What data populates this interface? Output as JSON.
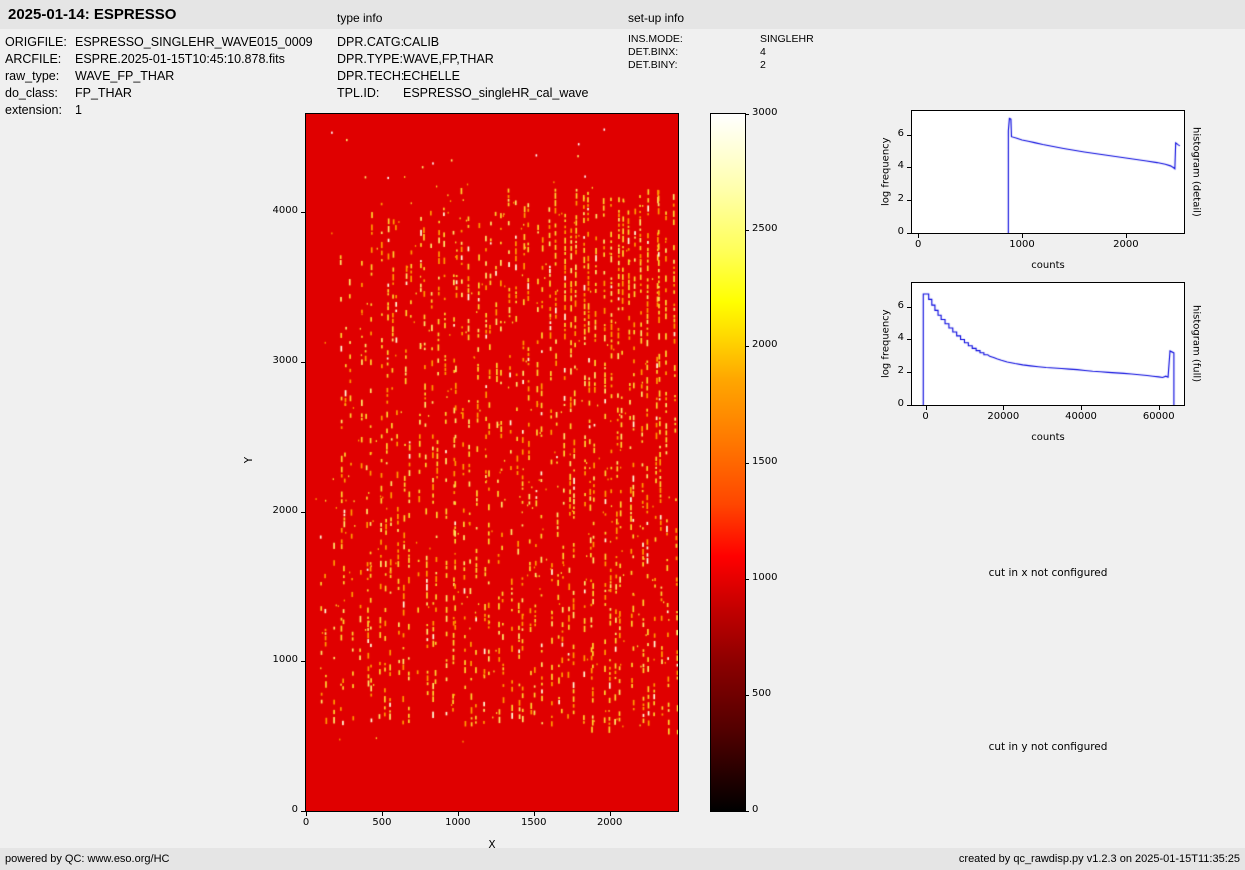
{
  "header": {
    "title": "2025-01-14: ESPRESSO",
    "type_info_label": "type info",
    "setup_info_label": "set-up info"
  },
  "file_info": {
    "rows": [
      {
        "label": "ORIGFILE:",
        "value": "ESPRESSO_SINGLEHR_WAVE015_0009"
      },
      {
        "label": "ARCFILE:",
        "value": "ESPRE.2025-01-15T10:45:10.878.fits"
      },
      {
        "label": "raw_type:",
        "value": "WAVE_FP_THAR"
      },
      {
        "label": "do_class:",
        "value": "FP_THAR"
      },
      {
        "label": "extension:",
        "value": "1"
      }
    ]
  },
  "type_info": {
    "rows": [
      {
        "label": "DPR.CATG:",
        "value": "CALIB"
      },
      {
        "label": "DPR.TYPE:",
        "value": "WAVE,FP,THAR"
      },
      {
        "label": "DPR.TECH:",
        "value": "ECHELLE"
      },
      {
        "label": "TPL.ID:",
        "value": "ESPRESSO_singleHR_cal_wave"
      }
    ]
  },
  "setup_info": {
    "rows": [
      {
        "label": "INS.MODE:",
        "value": "SINGLEHR"
      },
      {
        "label": "DET.BINX:",
        "value": "4"
      },
      {
        "label": "DET.BINY:",
        "value": "2"
      }
    ]
  },
  "notes": {
    "cut_x": "cut in x not configured",
    "cut_y": "cut in y not configured"
  },
  "footer": {
    "left": "powered by QC: www.eso.org/HC",
    "right": "created by qc_rawdisp.py v1.2.3 on 2025-01-15T11:35:25"
  },
  "chart_data": [
    {
      "id": "raw_image",
      "type": "heatmap",
      "xlabel": "X",
      "ylabel": "Y",
      "xlim": [
        0,
        2450
      ],
      "ylim": [
        0,
        4655
      ],
      "xticks": [
        0,
        500,
        1000,
        1500,
        2000
      ],
      "yticks": [
        0,
        1000,
        2000,
        3000,
        4000
      ],
      "colormap": "hot",
      "colorbar": {
        "min": 0,
        "max": 3000,
        "ticks": [
          0,
          500,
          1000,
          1500,
          2000,
          2500,
          3000
        ]
      },
      "background_counts": 1000,
      "background_color": "#e00000",
      "speckle_colors": [
        "#ffd22e",
        "#ff9b00",
        "#ffe96a",
        "#ffffd8"
      ],
      "speckle_region": {
        "x_min": 80,
        "x_max": 2440,
        "y_min": 520,
        "y_max": 4180
      },
      "n_order_stripes": 55,
      "description": "Raw ESPRESSO FP/ThAr calibration frame: uniform ~1000-count red background with yellow emission-line dashes along vertical echelle order stripes"
    },
    {
      "id": "histogram_detail",
      "type": "line",
      "right_label": "histogram (detail)",
      "xlabel": "counts",
      "ylabel": "log frequency",
      "xlim": [
        -60,
        2560
      ],
      "ylim": [
        0,
        7.45
      ],
      "xticks": [
        0,
        1000,
        2000
      ],
      "yticks": [
        0,
        2,
        4,
        6
      ],
      "line_color": "#0000dd",
      "points": [
        [
          868,
          0
        ],
        [
          868,
          6.25
        ],
        [
          878,
          7.0
        ],
        [
          893,
          6.95
        ],
        [
          898,
          5.88
        ],
        [
          950,
          5.78
        ],
        [
          1000,
          5.68
        ],
        [
          1060,
          5.6
        ],
        [
          1120,
          5.52
        ],
        [
          1200,
          5.4
        ],
        [
          1300,
          5.28
        ],
        [
          1400,
          5.16
        ],
        [
          1500,
          5.05
        ],
        [
          1600,
          4.95
        ],
        [
          1700,
          4.85
        ],
        [
          1800,
          4.76
        ],
        [
          1900,
          4.67
        ],
        [
          2000,
          4.58
        ],
        [
          2100,
          4.49
        ],
        [
          2200,
          4.4
        ],
        [
          2300,
          4.3
        ],
        [
          2380,
          4.2
        ],
        [
          2430,
          4.1
        ],
        [
          2460,
          3.98
        ],
        [
          2472,
          3.92
        ],
        [
          2480,
          5.5
        ],
        [
          2505,
          5.38
        ],
        [
          2520,
          5.32
        ]
      ]
    },
    {
      "id": "histogram_full",
      "type": "line",
      "right_label": "histogram (full)",
      "xlabel": "counts",
      "ylabel": "log frequency",
      "xlim": [
        -3500,
        66500
      ],
      "ylim": [
        0,
        7.45
      ],
      "xticks": [
        0,
        20000,
        40000,
        60000
      ],
      "yticks": [
        0,
        2,
        4,
        6
      ],
      "line_color": "#0000dd",
      "points": [
        [
          -600,
          0
        ],
        [
          -600,
          6.78
        ],
        [
          800,
          6.78
        ],
        [
          800,
          6.45
        ],
        [
          1600,
          6.45
        ],
        [
          1600,
          6.1
        ],
        [
          2400,
          6.1
        ],
        [
          2400,
          5.78
        ],
        [
          3200,
          5.78
        ],
        [
          3200,
          5.48
        ],
        [
          4000,
          5.48
        ],
        [
          4000,
          5.22
        ],
        [
          5000,
          5.22
        ],
        [
          5000,
          4.96
        ],
        [
          6000,
          4.96
        ],
        [
          6000,
          4.7
        ],
        [
          7000,
          4.7
        ],
        [
          7000,
          4.46
        ],
        [
          8000,
          4.46
        ],
        [
          8000,
          4.22
        ],
        [
          9000,
          4.22
        ],
        [
          9000,
          4.0
        ],
        [
          10000,
          4.0
        ],
        [
          10000,
          3.8
        ],
        [
          11000,
          3.8
        ],
        [
          11000,
          3.62
        ],
        [
          12000,
          3.62
        ],
        [
          12000,
          3.46
        ],
        [
          13000,
          3.46
        ],
        [
          13000,
          3.32
        ],
        [
          14000,
          3.32
        ],
        [
          14000,
          3.19
        ],
        [
          15000,
          3.19
        ],
        [
          15000,
          3.07
        ],
        [
          16000,
          3.07
        ],
        [
          16500,
          2.97
        ],
        [
          17500,
          2.9
        ],
        [
          18500,
          2.81
        ],
        [
          19500,
          2.73
        ],
        [
          21000,
          2.63
        ],
        [
          23000,
          2.53
        ],
        [
          25000,
          2.45
        ],
        [
          27000,
          2.39
        ],
        [
          29000,
          2.34
        ],
        [
          31000,
          2.29
        ],
        [
          33000,
          2.26
        ],
        [
          35000,
          2.23
        ],
        [
          37000,
          2.19
        ],
        [
          39000,
          2.16
        ],
        [
          41000,
          2.11
        ],
        [
          43000,
          2.06
        ],
        [
          45000,
          2.03
        ],
        [
          47000,
          1.99
        ],
        [
          49000,
          1.96
        ],
        [
          51000,
          1.93
        ],
        [
          53000,
          1.89
        ],
        [
          55000,
          1.85
        ],
        [
          57000,
          1.8
        ],
        [
          58500,
          1.76
        ],
        [
          60000,
          1.72
        ],
        [
          61000,
          1.68
        ],
        [
          61800,
          1.76
        ],
        [
          62400,
          1.7
        ],
        [
          62900,
          3.3
        ],
        [
          63900,
          3.18
        ],
        [
          63900,
          0
        ]
      ]
    }
  ]
}
